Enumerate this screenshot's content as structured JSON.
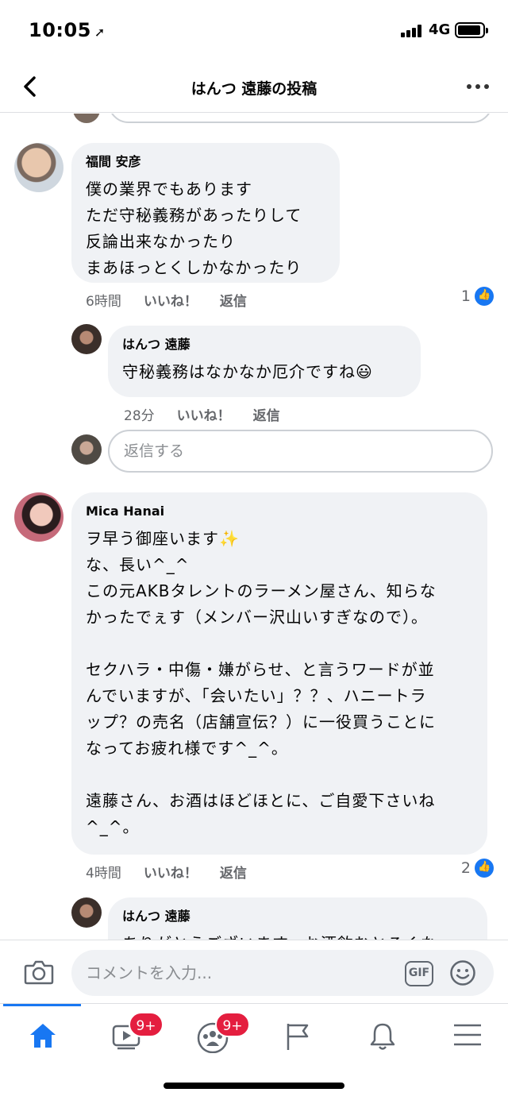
{
  "status_bar": {
    "time": "10:05",
    "network": "4G"
  },
  "header": {
    "title": "はんつ 遠藤の投稿"
  },
  "comments": [
    {
      "author": "福間 安彦",
      "text": "僕の業界でもあります\nただ守秘義務があったりして\n反論出来なかったり\nまあほっとくしかなかったり",
      "time": "6時間",
      "like_label": "いいね！",
      "reply_label": "返信",
      "like_count": "1"
    },
    {
      "author": "はんつ 遠藤",
      "text": "守秘義務はなかなか厄介ですね😃",
      "time": "28分",
      "like_label": "いいね！",
      "reply_label": "返信"
    },
    {
      "author": "Mica Hanai",
      "text": "ヲ早う御座います✨\nな、長い^_^\nこの元AKBタレントのラーメン屋さん、知らな\nかったでぇす（メンバー沢山いすぎなので）。\n\nセクハラ・中傷・嫌がらせ、と言うワードが並\nんでいますが、「会いたい」？？、ハニートラ\nップ？の売名（店舗宣伝？）に一役買うことに\nなってお疲れ様です^_^。\n\n遠藤さん、お酒はほどほとに、ご自愛下さいね\n^_^。",
      "time": "4時間",
      "like_label": "いいね！",
      "reply_label": "返信",
      "like_count": "2"
    },
    {
      "author": "はんつ 遠藤",
      "text": "ありがとうございます。お酒飲むとろくな"
    }
  ],
  "reply_box": {
    "placeholder": "返信する"
  },
  "comment_bar": {
    "placeholder": "コメントを入力...",
    "gif_label": "GIF"
  },
  "tabs": [
    {
      "name": "home",
      "icon": "home-icon",
      "active": true
    },
    {
      "name": "watch",
      "icon": "video-icon",
      "badge": "9+"
    },
    {
      "name": "groups",
      "icon": "groups-icon",
      "badge": "9+"
    },
    {
      "name": "pages",
      "icon": "flag-icon"
    },
    {
      "name": "notifications",
      "icon": "bell-icon"
    },
    {
      "name": "menu",
      "icon": "menu-icon"
    }
  ],
  "colors": {
    "accent": "#1877f2",
    "badge": "#e41e3f",
    "bubble": "#f0f2f5",
    "meta": "#65676b"
  }
}
